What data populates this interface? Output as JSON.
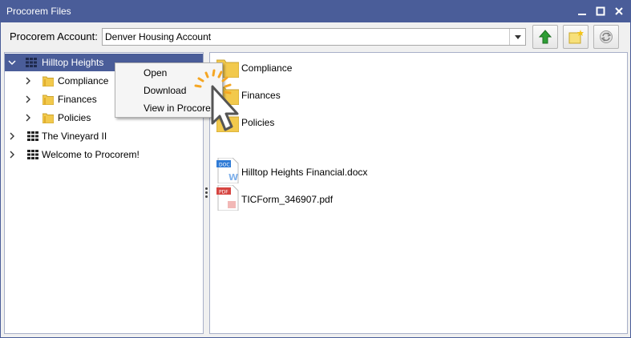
{
  "window": {
    "title": "Procorem Files"
  },
  "account": {
    "label": "Procorem Account:",
    "selected": "Denver Housing Account"
  },
  "toolbar": {
    "up_icon": "green-up-arrow-icon",
    "new_icon": "new-folder-icon",
    "refresh_icon": "refresh-icon"
  },
  "tree": {
    "items": [
      {
        "label": "Hilltop Heights",
        "icon": "grid-icon",
        "expanded": true,
        "selected": true,
        "level": 0
      },
      {
        "label": "Compliance",
        "icon": "folder-icon",
        "expanded": false,
        "level": 1
      },
      {
        "label": "Finances",
        "icon": "folder-icon",
        "expanded": false,
        "level": 1
      },
      {
        "label": "Policies",
        "icon": "folder-icon",
        "expanded": false,
        "level": 1
      },
      {
        "label": "The Vineyard II",
        "icon": "grid-icon",
        "expanded": false,
        "level": 0
      },
      {
        "label": "Welcome to Procorem!",
        "icon": "grid-icon",
        "expanded": false,
        "level": 0
      }
    ]
  },
  "list": {
    "items": [
      {
        "label": "Compliance",
        "icon": "folder-icon"
      },
      {
        "label": "Finances",
        "icon": "folder-icon"
      },
      {
        "label": "Policies",
        "icon": "folder-icon"
      },
      {
        "label": "Hilltop Heights Financial.docx",
        "icon": "docx-icon",
        "badge": "DOC"
      },
      {
        "label": "TICForm_346907.pdf",
        "icon": "pdf-icon",
        "badge": "PDF"
      }
    ]
  },
  "context_menu": {
    "items": [
      "Open",
      "Download",
      "View in Procorem"
    ]
  },
  "colors": {
    "titlebar": "#4a5d99",
    "selection": "#4a5d99",
    "folder": "#f2c94c",
    "click_burst": "#f5a623"
  }
}
